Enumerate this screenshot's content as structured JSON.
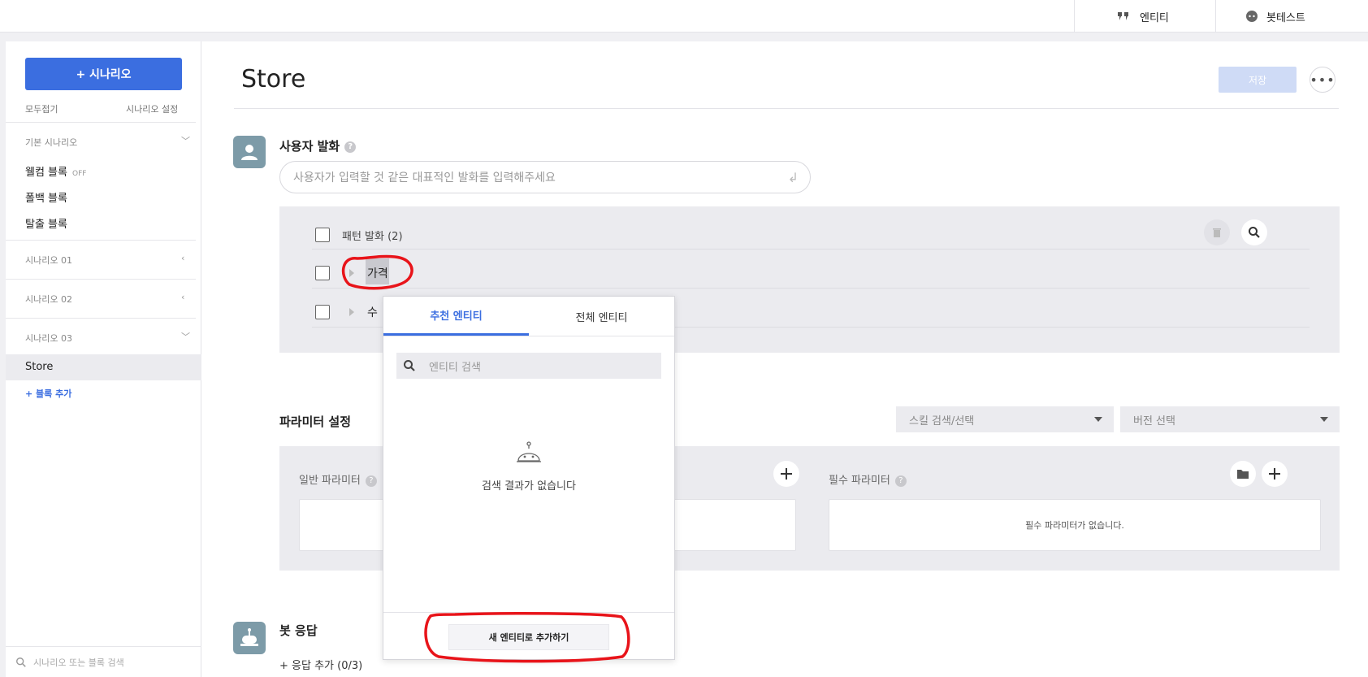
{
  "topbar": {
    "entity_label": "엔티티",
    "bottest_label": "봇테스트"
  },
  "sidebar": {
    "add_scenario": "+ 시나리오",
    "collapse_all": "모두접기",
    "scenario_settings": "시나리오 설정",
    "groups": [
      {
        "label": "기본 시나리오",
        "expanded": true
      },
      {
        "label": "시나리오 01",
        "expanded": false
      },
      {
        "label": "시나리오 02",
        "expanded": false
      },
      {
        "label": "시나리오 03",
        "expanded": true
      }
    ],
    "default_items": [
      {
        "label": "웰컴 블록",
        "badge": "OFF"
      },
      {
        "label": "폴백 블록",
        "badge": ""
      },
      {
        "label": "탈출 블록",
        "badge": ""
      }
    ],
    "active_item": "Store",
    "add_block": "+ 블록 추가",
    "search_placeholder": "시나리오 또는 블록 검색"
  },
  "main": {
    "title": "Store",
    "save_label": "저장",
    "user_utterance": {
      "title": "사용자 발화",
      "placeholder": "사용자가 입력할 것 같은 대표적인 발화를 입력해주세요",
      "pattern_header": "패턴 발화 (2)",
      "rows": [
        "가격",
        "수"
      ]
    },
    "params": {
      "title": "파라미터 설정",
      "skill_select": "스킬 검색/선택",
      "version_select": "버전 선택",
      "general_label": "일반 파라미터",
      "required_label": "필수 파라미터",
      "required_empty": "필수 파라미터가 없습니다."
    },
    "bot_response": {
      "title": "봇 응답",
      "add_response": "+ 응답 추가 (0/3)"
    }
  },
  "entity_popup": {
    "tabs": [
      "추천 엔티티",
      "전체 엔티티"
    ],
    "active_tab": 0,
    "search_placeholder": "엔티티 검색",
    "empty_message": "검색 결과가 없습니다",
    "new_entity_button": "새 엔티티로 추가하기"
  },
  "colors": {
    "accent": "#3b6ee0",
    "annotation": "#e8141a"
  }
}
